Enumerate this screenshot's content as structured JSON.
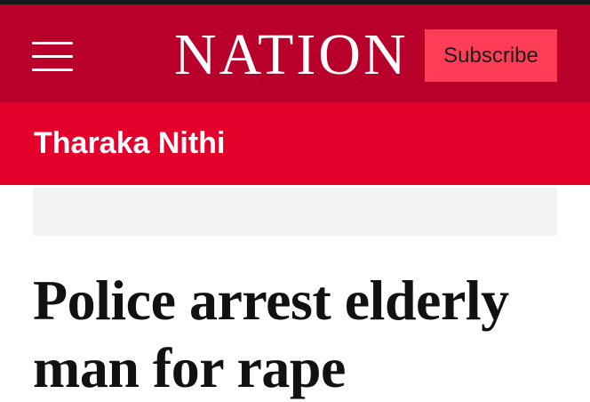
{
  "header": {
    "logo_text": "NATION",
    "subscribe_label": "Subscribe",
    "menu_icon": "hamburger-menu-icon",
    "colors": {
      "header_bg": "#b8002a",
      "subscribe_bg": "#ff3d57"
    }
  },
  "section": {
    "title": "Tharaka Nithi",
    "color": "#e4002b"
  },
  "article": {
    "headline": "Police arrest elderly man for rape"
  }
}
